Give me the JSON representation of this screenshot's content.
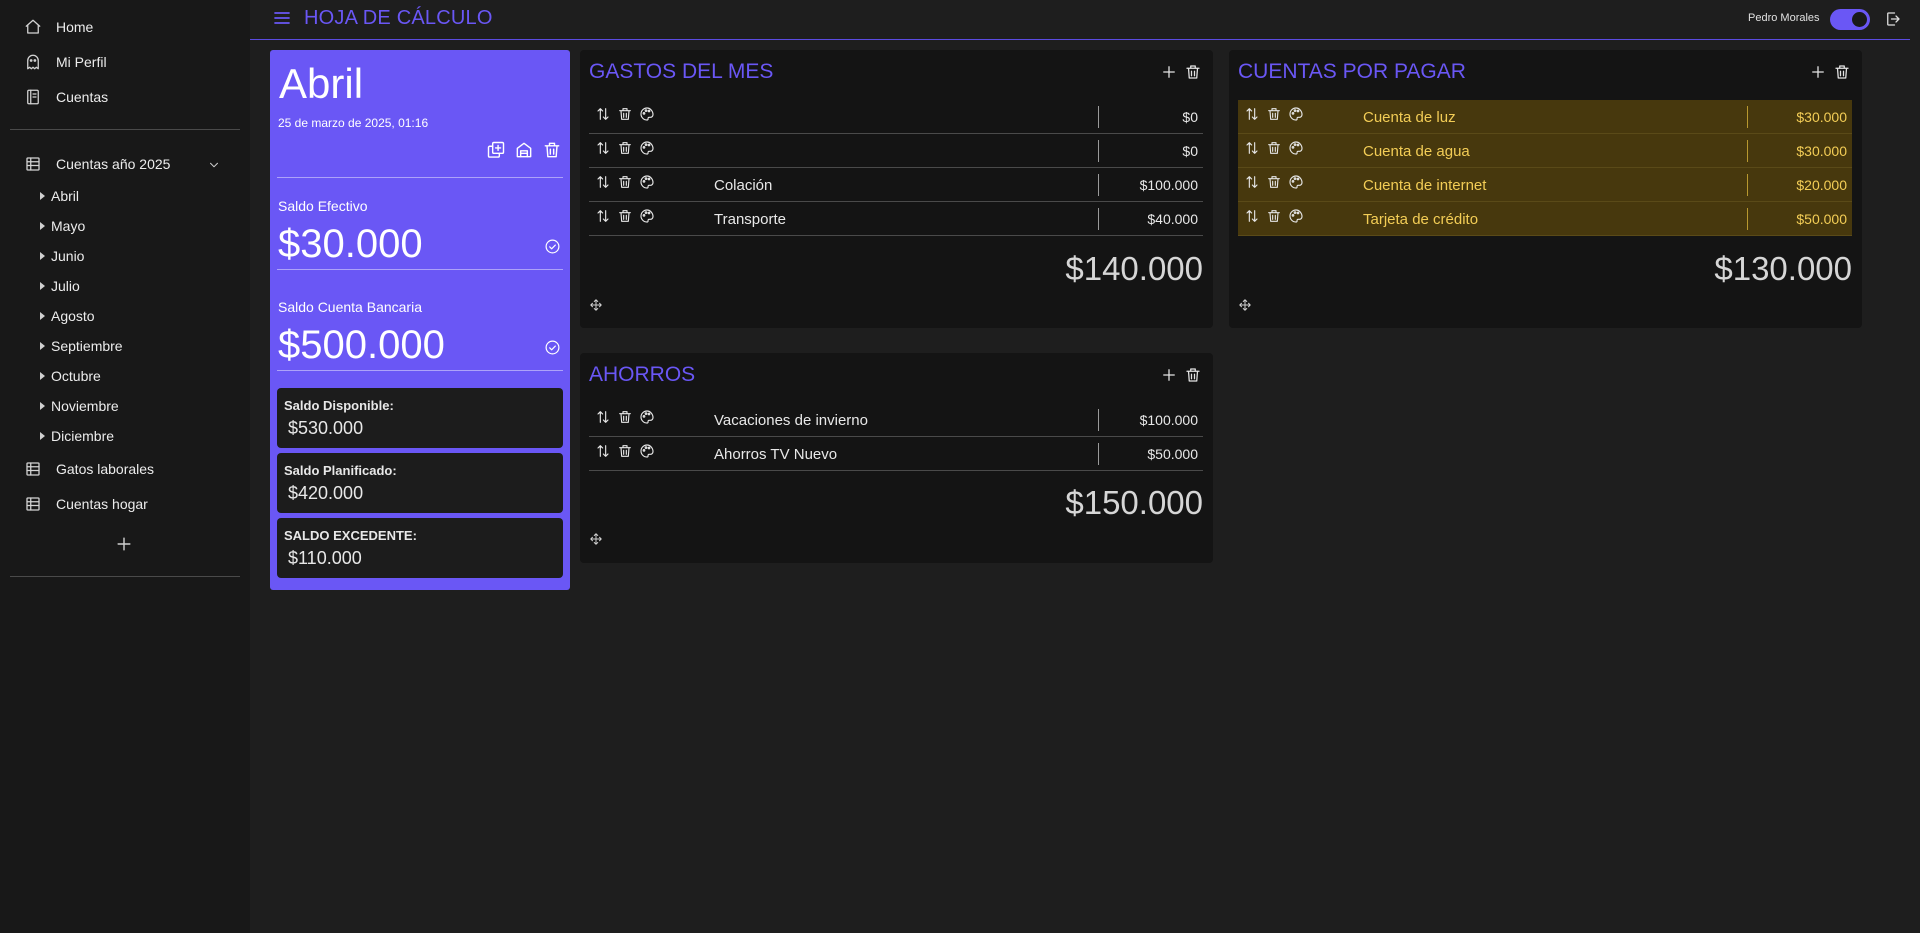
{
  "sidebar": {
    "nav": [
      {
        "label": "Home",
        "icon": "home-icon"
      },
      {
        "label": "Mi Perfil",
        "icon": "ghost-icon"
      },
      {
        "label": "Cuentas",
        "icon": "notebook-icon"
      }
    ],
    "group": {
      "label": "Cuentas año 2025",
      "icon": "table-icon",
      "expanded": true,
      "months": [
        "Abril",
        "Mayo",
        "Junio",
        "Julio",
        "Agosto",
        "Septiembre",
        "Octubre",
        "Noviembre",
        "Diciembre"
      ]
    },
    "sheets": [
      {
        "label": "Gatos laborales",
        "icon": "table-icon"
      },
      {
        "label": "Cuentas hogar",
        "icon": "table-icon"
      }
    ],
    "add_icon": "plus-icon"
  },
  "header": {
    "title": "HOJA DE CÁLCULO",
    "user": "Pedro Morales",
    "theme_toggle_on": true
  },
  "month_card": {
    "title": "Abril",
    "date": "25 de marzo de 2025, 01:16",
    "cash_label": "Saldo Efectivo",
    "cash_value": "$30.000",
    "bank_label": "Saldo Cuenta Bancaria",
    "bank_value": "$500.000",
    "available_label": "Saldo Disponible:",
    "available_value": "$530.000",
    "planned_label": "Saldo Planificado:",
    "planned_value": "$420.000",
    "surplus_label": "SALDO EXCEDENTE:",
    "surplus_value": "$110.000"
  },
  "gastos": {
    "title": "GASTOS DEL MES",
    "rows": [
      {
        "name": "",
        "amount": "$0"
      },
      {
        "name": "",
        "amount": "$0"
      },
      {
        "name": "Colación",
        "amount": "$100.000"
      },
      {
        "name": "Transporte",
        "amount": "$40.000"
      }
    ],
    "total": "$140.000"
  },
  "cuentas": {
    "title": "CUENTAS POR PAGAR",
    "rows": [
      {
        "name": "Cuenta de luz",
        "amount": "$30.000"
      },
      {
        "name": "Cuenta de agua",
        "amount": "$30.000"
      },
      {
        "name": "Cuenta de internet",
        "amount": "$20.000"
      },
      {
        "name": "Tarjeta de crédito",
        "amount": "$50.000"
      }
    ],
    "total": "$130.000"
  },
  "ahorros": {
    "title": "AHORROS",
    "rows": [
      {
        "name": "Vacaciones de invierno",
        "amount": "$100.000"
      },
      {
        "name": "Ahorros TV Nuevo",
        "amount": "$50.000"
      }
    ],
    "total": "$150.000"
  },
  "colors": {
    "accent": "#6a57f5",
    "background": "#1e1e1e",
    "sidebar": "#181818",
    "panel": "#141414",
    "highlight_row": "#47380d",
    "highlight_text": "#f3cd56"
  }
}
